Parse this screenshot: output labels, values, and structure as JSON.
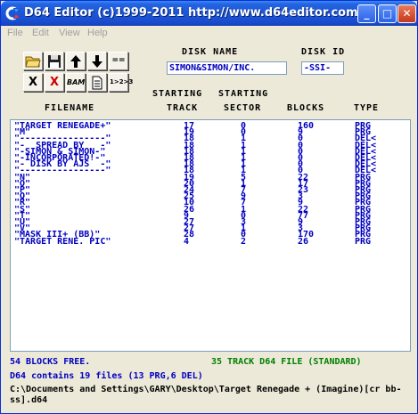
{
  "window": {
    "title": "D64 Editor (c)1999-2011 http://www.d64editor.com/",
    "buttons": {
      "minimize": "_",
      "maximize": "□",
      "close": "✕"
    }
  },
  "menu": [
    "File",
    "Edit",
    "View",
    "Help"
  ],
  "toolbar": {
    "row1": [
      "open-icon",
      "save-icon",
      "arrow-up-icon",
      "arrow-down-icon",
      "=="
    ],
    "row2": [
      "X",
      "X",
      "BAM",
      "document-icon",
      "1>2>3"
    ]
  },
  "disk": {
    "name_label": "DISK NAME",
    "name_value": "SIMON&SIMON/INC.",
    "id_label": "DISK ID",
    "id_value": "-SSI-"
  },
  "columns": {
    "starting1": "STARTING",
    "starting2": "STARTING",
    "filename": "FILENAME",
    "track": "TRACK",
    "sector": "SECTOR",
    "blocks": "BLOCKS",
    "type": "TYPE"
  },
  "files": [
    {
      "name": "\"TARGET RENEGADE+\"",
      "track": "17",
      "sector": "0",
      "blocks": "160",
      "type": "PRG"
    },
    {
      "name": "\"M\"",
      "track": "19",
      "sector": "0",
      "blocks": "9",
      "type": "PRG"
    },
    {
      "name": "\"----------------\"",
      "track": "18",
      "sector": "1",
      "blocks": "0",
      "type": "DEL<"
    },
    {
      "name": "\"-  SPREAD BY   -\"",
      "track": "18",
      "sector": "1",
      "blocks": "0",
      "type": "DEL<"
    },
    {
      "name": "\"-SIMON & SIMON-\"",
      "track": "18",
      "sector": "1",
      "blocks": "0",
      "type": "DEL<"
    },
    {
      "name": "\"-INCORPORATED!-\"",
      "track": "18",
      "sector": "1",
      "blocks": "0",
      "type": "DEL<"
    },
    {
      "name": "\"- DISK BY AJS  -\"",
      "track": "18",
      "sector": "1",
      "blocks": "0",
      "type": "DEL<"
    },
    {
      "name": "\"----------------\"",
      "track": "18",
      "sector": "1",
      "blocks": "0",
      "type": "DEL<"
    },
    {
      "name": "\"N\"",
      "track": "19",
      "sector": "5",
      "blocks": "22",
      "type": "PRG"
    },
    {
      "name": "\"O\"",
      "track": "20",
      "sector": "1",
      "blocks": "17",
      "type": "PRG"
    },
    {
      "name": "\"P\"",
      "track": "24",
      "sector": "7",
      "blocks": "23",
      "type": "PRG"
    },
    {
      "name": "\"Q\"",
      "track": "25",
      "sector": "9",
      "blocks": "3",
      "type": "PRG"
    },
    {
      "name": "\"R\"",
      "track": "10",
      "sector": "7",
      "blocks": "9",
      "type": "PRG"
    },
    {
      "name": "\"S\"",
      "track": "26",
      "sector": "1",
      "blocks": "22",
      "type": "PRG"
    },
    {
      "name": "\"T\"",
      "track": "9",
      "sector": "0",
      "blocks": "77",
      "type": "PRG"
    },
    {
      "name": "\"U\"",
      "track": "27",
      "sector": "3",
      "blocks": "9",
      "type": "PRG"
    },
    {
      "name": "\"V\"",
      "track": "27",
      "sector": "1",
      "blocks": "3",
      "type": "PRG"
    },
    {
      "name": "\"MASK III+ (BB)\"",
      "track": "28",
      "sector": "0",
      "blocks": "170",
      "type": "PRG"
    },
    {
      "name": "\"TARGET RENE. PIC\"",
      "track": "4",
      "sector": "2",
      "blocks": "26",
      "type": "PRG"
    }
  ],
  "status": {
    "blocks_free": "54 BLOCKS FREE.",
    "disk_format": "35 TRACK D64 FILE (STANDARD)",
    "contents": "D64 contains 19 files (13 PRG,6 DEL)",
    "path": "C:\\Documents and Settings\\GARY\\Desktop\\Target Renegade + (Imagine)[cr bb-ss].d64"
  },
  "colors": {
    "list_text": "#0000c0",
    "blocks_free": "#0000c0",
    "disk_format": "#008000",
    "titlebar": "#1c55d6"
  }
}
